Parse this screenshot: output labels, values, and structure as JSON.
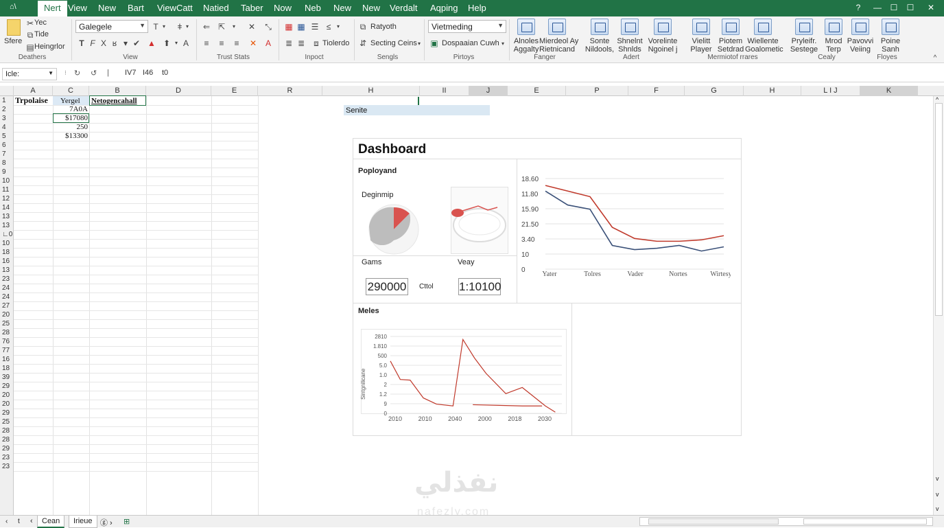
{
  "menu": {
    "items": [
      "Nert",
      "View",
      "New",
      "Bart",
      "ViewCatt",
      "Natied",
      "Taber",
      "Now",
      "Neb",
      "New",
      "New",
      "Verdalt",
      "Aqping",
      "Help"
    ],
    "left_glyph": "⌂\\",
    "active_index": 0
  },
  "ribbon": {
    "clipboard": {
      "paste_label": "Sfere",
      "items": [
        "Yec",
        "Tide",
        "Heingrlor"
      ],
      "group": "Deathers"
    },
    "font": {
      "font_name": "Galegele",
      "group": "View"
    },
    "align": {
      "group": "Trust Stats"
    },
    "insert": {
      "label": "Tiolerdo",
      "group": "Inpoct"
    },
    "search": {
      "label1": "Ratyoth",
      "label2": "Secting Ceins",
      "group": "Sengls"
    },
    "style": {
      "dropdown": "Vietmeding",
      "label": "Dospaaian Cuwh",
      "group": "Pirtoys"
    },
    "big_buttons": [
      {
        "label": "Alnoles\nAggalty",
        "group_anchor": false
      },
      {
        "label": "Mierdeol Ay\nRietnicand",
        "group_anchor": false
      },
      {
        "label": "Sonte\nNildools,",
        "group_anchor": false
      },
      {
        "label": "Shnelnt\nShnlds",
        "group_anchor": false
      },
      {
        "label": "Vorelinte\nNgoinel j",
        "group_anchor": false
      },
      {
        "label": "Vielitt\nPlayer",
        "group_anchor": false
      },
      {
        "label": "Piotem\nSetdrad",
        "group_anchor": false
      },
      {
        "label": "Wiellente\nGoalometic",
        "group_anchor": false
      },
      {
        "label": "Pryleifr.\nSestege",
        "group_anchor": false
      },
      {
        "label": "Mrod\nTerp",
        "group_anchor": false
      },
      {
        "label": "Pavovvi\nVeiing",
        "group_anchor": false
      },
      {
        "label": "Poine\nSanh",
        "group_anchor": false
      }
    ],
    "groups2": [
      "Fanger",
      "Adert",
      "Mermiotof rrares",
      "Cealy",
      "Floyes"
    ]
  },
  "formula": {
    "name_box": "Icle:",
    "fx": "IV7",
    "content": "I46",
    "content2": "t0"
  },
  "columns": [
    {
      "label": "A",
      "sel": false
    },
    {
      "label": "C",
      "sel": false
    },
    {
      "label": "B",
      "sel": false
    },
    {
      "label": "D",
      "sel": false
    },
    {
      "label": "E",
      "sel": false
    },
    {
      "label": "R",
      "sel": false
    },
    {
      "label": "H",
      "sel": false
    },
    {
      "label": "II",
      "sel": false
    },
    {
      "label": "J",
      "sel": true
    },
    {
      "label": "E",
      "sel": false
    },
    {
      "label": "P",
      "sel": false
    },
    {
      "label": "F",
      "sel": false
    },
    {
      "label": "G",
      "sel": false
    },
    {
      "label": "H",
      "sel": false
    },
    {
      "label": "L I J",
      "sel": false
    },
    {
      "label": "K",
      "sel": true
    }
  ],
  "rows": [
    "1",
    "2",
    "3",
    "4",
    "5",
    "6",
    "7",
    "8",
    "9",
    "10",
    "11",
    "12",
    "14",
    "13",
    "13",
    "∟0",
    "10",
    "18",
    "16",
    "13",
    "23",
    "24",
    "24",
    "27",
    "20",
    "25",
    "28",
    "76",
    "77",
    "16",
    "18",
    "39",
    "29",
    "20",
    "20",
    "29",
    "25",
    "28",
    "28",
    "29",
    "23",
    "23"
  ],
  "cells": {
    "a1": "Trpolaise",
    "c1": "Yergel",
    "b1": "Netogencahall",
    "c2": "7A0A",
    "c3": "$17080",
    "c4": "250",
    "c5": "$13300"
  },
  "name_strip": "Senite",
  "dashboard": {
    "title": "Dashboard",
    "panel1_title": "Poployand",
    "donut_label": "Deginmip",
    "gains_label": "Gams",
    "vary_label": "Veay",
    "kpi1": "290000",
    "kpi_mid": "Cttol",
    "kpi2": "1:10100",
    "bottom_title": "Meles"
  },
  "chart_data": [
    {
      "type": "line",
      "title": "",
      "categories": [
        "Yater",
        "Tolres",
        "Vader",
        "Nortes",
        "Wirtesy"
      ],
      "x": [
        0,
        0.5,
        1,
        1.5,
        2,
        2.5,
        3,
        3.5,
        4
      ],
      "yticks": [
        "18.60",
        "11.80",
        "15.90",
        "21.50",
        "3.40",
        "10",
        "0"
      ],
      "series": [
        {
          "color": "#c0392b",
          "y": [
            6,
            5.6,
            5.2,
            3.0,
            2.2,
            2.0,
            2.0,
            2.1,
            2.4
          ]
        },
        {
          "color": "#3a5078",
          "y": [
            5.6,
            4.6,
            4.3,
            1.7,
            1.4,
            1.5,
            1.7,
            1.3,
            1.6
          ]
        }
      ],
      "ylim": [
        0,
        6.5
      ]
    },
    {
      "type": "line",
      "title": "",
      "xticks": [
        "2010",
        "2010",
        "2040",
        "2000",
        "2018",
        "2030"
      ],
      "yticks": [
        "2810",
        "1.810",
        "500",
        "5.0",
        "1.0",
        "2",
        "1.2",
        "9",
        "0"
      ],
      "ylabel": "Sintgnilicane",
      "series": [
        {
          "color": "#c0392b",
          "x": [
            0,
            0.3,
            0.6,
            1.0,
            1.4,
            1.9,
            2.2,
            2.55,
            2.9,
            3.5,
            4.0,
            4.7,
            5.0
          ],
          "y": [
            8.5,
            5.5,
            5.4,
            2.5,
            1.5,
            1.2,
            12,
            9,
            6.5,
            3.2,
            4.2,
            1.2,
            0.2
          ]
        },
        {
          "color": "#c0392b",
          "x": [
            2.5,
            3.3,
            4.0,
            4.6
          ],
          "y": [
            1.4,
            1.3,
            1.2,
            1.2
          ]
        }
      ],
      "xlim": [
        0,
        5.2
      ],
      "ylim": [
        0,
        12.5
      ]
    }
  ],
  "bottom": {
    "tabs": [
      "Cean",
      "Irieue"
    ],
    "nav": "ⓖ ›"
  }
}
